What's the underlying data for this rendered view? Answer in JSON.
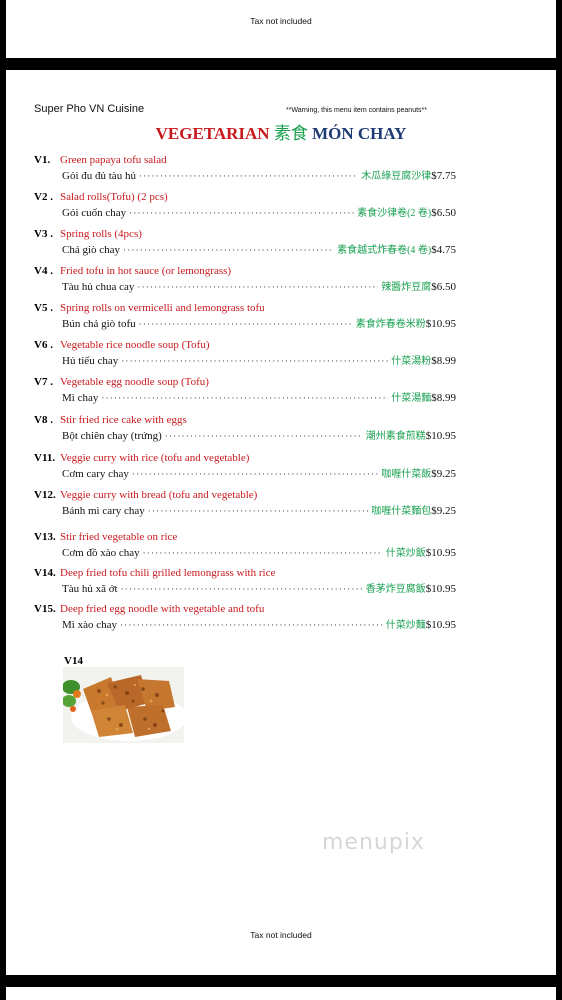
{
  "header": {
    "tax_note": "Tax not included"
  },
  "menu": {
    "restaurant": "Super Pho VN Cuisine",
    "warning": "**Warning, this menu item contains peanuts**",
    "title": {
      "en": "VEGETARIAN",
      "zh": "素食",
      "vi": "MÓN CHAY"
    },
    "items": [
      {
        "code": "V1.",
        "en": "Green papaya tofu salad",
        "vi": "Gỏi đu đủ tàu hủ",
        "zh": "木瓜綠豆腐沙律",
        "price": "$7.75"
      },
      {
        "code": "V2 .",
        "en": "Salad rolls(Tofu) (2 pcs)",
        "vi": "Gỏi cuốn chay",
        "zh": "素食沙律卷(2 卷)",
        "price": "$6.50"
      },
      {
        "code": "V3 .",
        "en": "Spring rolls (4pcs)",
        "vi": "Chả giò chay",
        "zh": "素食越式炸春卷(4 卷)",
        "price": "$4.75"
      },
      {
        "code": "V4 .",
        "en": "Fried tofu in hot sauce (or lemongrass)",
        "vi": "Tàu hủ chua cay",
        "zh": "辣醬炸豆腐",
        "price": "$6.50"
      },
      {
        "code": "V5 .",
        "en": "Spring rolls on vermicelli and lemongrass tofu",
        "vi": "Bún chả giò tofu",
        "zh": "素食炸春卷米粉",
        "price": "$10.95"
      },
      {
        "code": "V6 .",
        "en": "Vegetable rice noodle soup (Tofu)",
        "vi": "Hủ tiếu chay",
        "zh": "什菜湯粉",
        "price": "$8.99"
      },
      {
        "code": "V7 .",
        "en": "Vegetable egg noodle soup (Tofu)",
        "vi": "Mì chay",
        "zh": "什菜湯麵",
        "price": "$8.99"
      },
      {
        "code": "V8 .",
        "en": "Stir fried rice cake with eggs",
        "vi": "Bột chiên chay (trứng)",
        "zh": "潮州素食煎糕",
        "price": "$10.95"
      },
      {
        "code": "V11.",
        "en": "Veggie curry with rice (tofu and vegetable)",
        "vi": "Cơm cary chay",
        "zh": "咖喱什菜飯",
        "price": "$9.25"
      },
      {
        "code": "V12.",
        "en": "Veggie curry with bread (tofu and vegetable)",
        "vi": "Bánh mì cary chay",
        "zh": "咖喱什菜麵包",
        "price": "$9.25"
      },
      {
        "code": "V13.",
        "en": "Stir fried vegetable on rice",
        "vi": "Cơm đồ xào chay",
        "zh": "什菜炒飯",
        "price": "$10.95"
      },
      {
        "code": "V14.",
        "en": "Deep fried tofu chili grilled lemongrass with rice",
        "vi": "Tàu hủ xã ớt",
        "zh": "香茅炸豆腐飯",
        "price": "$10.95"
      },
      {
        "code": "V15.",
        "en": "Deep fried egg noodle with vegetable and tofu",
        "vi": "Mì xào chay",
        "zh": "什菜炒麵",
        "price": "$10.95"
      }
    ],
    "photo_label": "V14",
    "footer_tax_note": "Tax not included"
  },
  "watermark": "menupix",
  "colors": {
    "item_english": "#c8191e",
    "item_chinese": "#18a050",
    "title_red": "#c8191e",
    "title_navy": "#1f3b74"
  }
}
